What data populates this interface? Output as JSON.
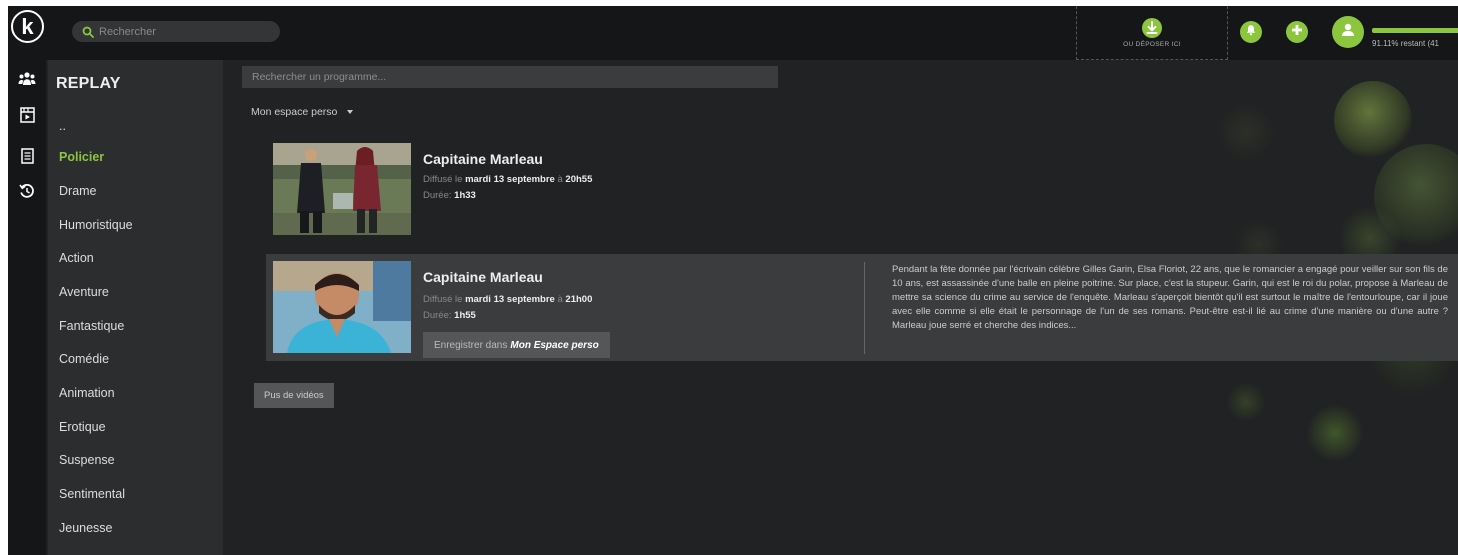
{
  "topbar": {
    "logo_letter": "k",
    "search_placeholder": "Rechercher",
    "dropzone_label": "OU DÉPOSER ICI",
    "quota_text": "91.11% restant (41",
    "quota_fraction": 0.9111
  },
  "sidebar": {
    "title": "REPLAY",
    "items": [
      {
        "label": "..",
        "active": false
      },
      {
        "label": "Policier",
        "active": true
      },
      {
        "label": "Drame",
        "active": false
      },
      {
        "label": "Humoristique",
        "active": false
      },
      {
        "label": "Action",
        "active": false
      },
      {
        "label": "Aventure",
        "active": false
      },
      {
        "label": "Fantastique",
        "active": false
      },
      {
        "label": "Comédie",
        "active": false
      },
      {
        "label": "Animation",
        "active": false
      },
      {
        "label": "Erotique",
        "active": false
      },
      {
        "label": "Suspense",
        "active": false
      },
      {
        "label": "Sentimental",
        "active": false
      },
      {
        "label": "Jeunesse",
        "active": false
      }
    ]
  },
  "rail": {
    "icons": [
      "group-icon",
      "clapperboard-icon",
      "document-list-icon",
      "history-icon"
    ]
  },
  "main": {
    "program_search_placeholder": "Rechercher un programme...",
    "space_select": "Mon espace perso",
    "programs": [
      {
        "title": "Capitaine Marleau",
        "broadcast_prefix": "Diffusé le",
        "broadcast_date": "mardi 13 septembre",
        "broadcast_at": "à",
        "broadcast_time": "20h55",
        "duration_label": "Durée:",
        "duration": "1h33"
      },
      {
        "title": "Capitaine Marleau",
        "broadcast_prefix": "Diffusé le",
        "broadcast_date": "mardi 13 septembre",
        "broadcast_at": "à",
        "broadcast_time": "21h00",
        "duration_label": "Durée:",
        "duration": "1h55",
        "record_prefix": "Enregistrer dans",
        "record_target": "Mon Espace perso",
        "synopsis": "Pendant la fête donnée par l'écrivain célèbre Gilles Garin, Elsa Floriot, 22 ans, que le romancier a engagé pour veiller sur son fils de 10 ans, est assassinée d'une balle en pleine poitrine. Sur place, c'est la stupeur. Garin, qui est le roi du polar, propose à Marleau de mettre sa science du crime au service de l'enquête. Marleau s'aperçoit bientôt qu'il est surtout le maître de l'entourloupe, car il joue avec elle comme si elle était le personnage de l'un de ses romans. Peut-être est-il lié au crime d'une manière ou d'une autre ? Marleau joue serré et cherche des indices..."
      }
    ],
    "more_label": "Pus de vidéos"
  },
  "colors": {
    "accent": "#8cc63f",
    "background": "#212223",
    "topbar": "#151617",
    "sidebar": "#2b2d2f"
  }
}
